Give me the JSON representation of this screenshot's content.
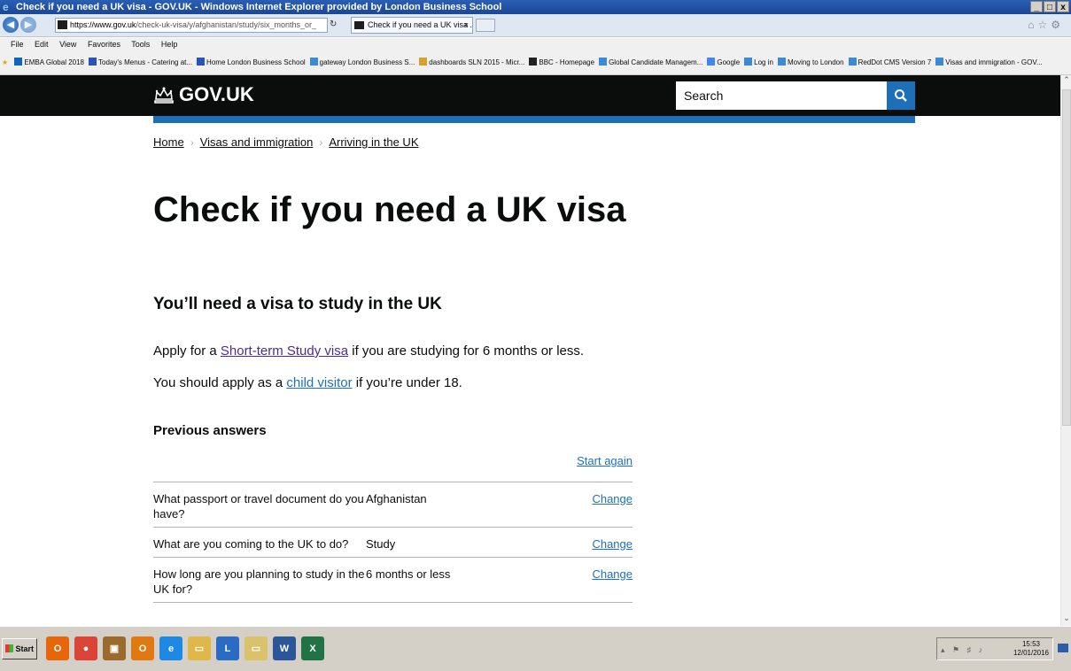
{
  "window": {
    "title": "Check if you need a UK visa - GOV.UK - Windows Internet Explorer provided by London Business School",
    "controls": [
      "_",
      "□",
      "x"
    ]
  },
  "browser": {
    "url_prefix": "https://www.gov.uk",
    "url_rest": "/check-uk-visa/y/afghanistan/study/six_months_or_",
    "tab_title": "Check if you need a UK visa ...",
    "menu": [
      "File",
      "Edit",
      "View",
      "Favorites",
      "Tools",
      "Help"
    ],
    "favorites": [
      {
        "label": "EMBA Global 2018",
        "color": "#0a66c2"
      },
      {
        "label": "Today's Menus - Catering at...",
        "color": "#2a52be"
      },
      {
        "label": "Home London Business School",
        "color": "#2a52be"
      },
      {
        "label": "gateway London Business S...",
        "color": "#3a8ad8"
      },
      {
        "label": "dashboards SLN 2015 - Micr...",
        "color": "#d8a02a"
      },
      {
        "label": "BBC - Homepage",
        "color": "#222222"
      },
      {
        "label": "Global Candidate Managem...",
        "color": "#3a8ad8"
      },
      {
        "label": "Google",
        "color": "#4285f4"
      },
      {
        "label": "Log in",
        "color": "#3a8ad8"
      },
      {
        "label": "Moving to London",
        "color": "#3a8ad8"
      },
      {
        "label": "RedDot CMS Version 7",
        "color": "#3a8ad8"
      },
      {
        "label": "Visas and immigration - GOV...",
        "color": "#3a8ad8"
      }
    ]
  },
  "header": {
    "logo_text": "GOV.UK",
    "search_placeholder": "Search"
  },
  "breadcrumb": [
    "Home",
    "Visas and immigration",
    "Arriving in the UK"
  ],
  "page": {
    "title": "Check if you need a UK visa",
    "result_heading": "You’ll need a visa to study in the UK",
    "p1_before": "Apply for a ",
    "p1_link": "Short-term Study visa",
    "p1_after": " if you are studying for 6 months or less.",
    "p2_before": "You should apply as a ",
    "p2_link": "child visitor",
    "p2_after": " if you’re under 18."
  },
  "previous_answers": {
    "heading": "Previous answers",
    "start_again": "Start again",
    "rows": [
      {
        "question": "What passport or travel document do you have?",
        "answer": "Afghanistan",
        "action": "Change"
      },
      {
        "question": "What are you coming to the UK to do?",
        "answer": "Study",
        "action": "Change"
      },
      {
        "question": "How long are you planning to study in the UK for?",
        "answer": "6 months or less",
        "action": "Change"
      }
    ]
  },
  "taskbar": {
    "start_label": "Start",
    "apps": [
      {
        "name": "outlook",
        "glyph": "O",
        "color": "#e8660a"
      },
      {
        "name": "chrome",
        "glyph": "●",
        "color": "#db4437"
      },
      {
        "name": "gift",
        "glyph": "▣",
        "color": "#9a6b2c"
      },
      {
        "name": "onenote",
        "glyph": "O",
        "color": "#e07a10"
      },
      {
        "name": "internet-explorer",
        "glyph": "e",
        "color": "#1e88e5"
      },
      {
        "name": "folder",
        "glyph": "▭",
        "color": "#e0b84a"
      },
      {
        "name": "lync",
        "glyph": "L",
        "color": "#2a6bc4"
      },
      {
        "name": "folder-2",
        "glyph": "▭",
        "color": "#d9c26a"
      },
      {
        "name": "word",
        "glyph": "W",
        "color": "#2b579a"
      },
      {
        "name": "excel",
        "glyph": "X",
        "color": "#217346"
      }
    ],
    "time": "15:53",
    "date": "12/01/2016"
  }
}
